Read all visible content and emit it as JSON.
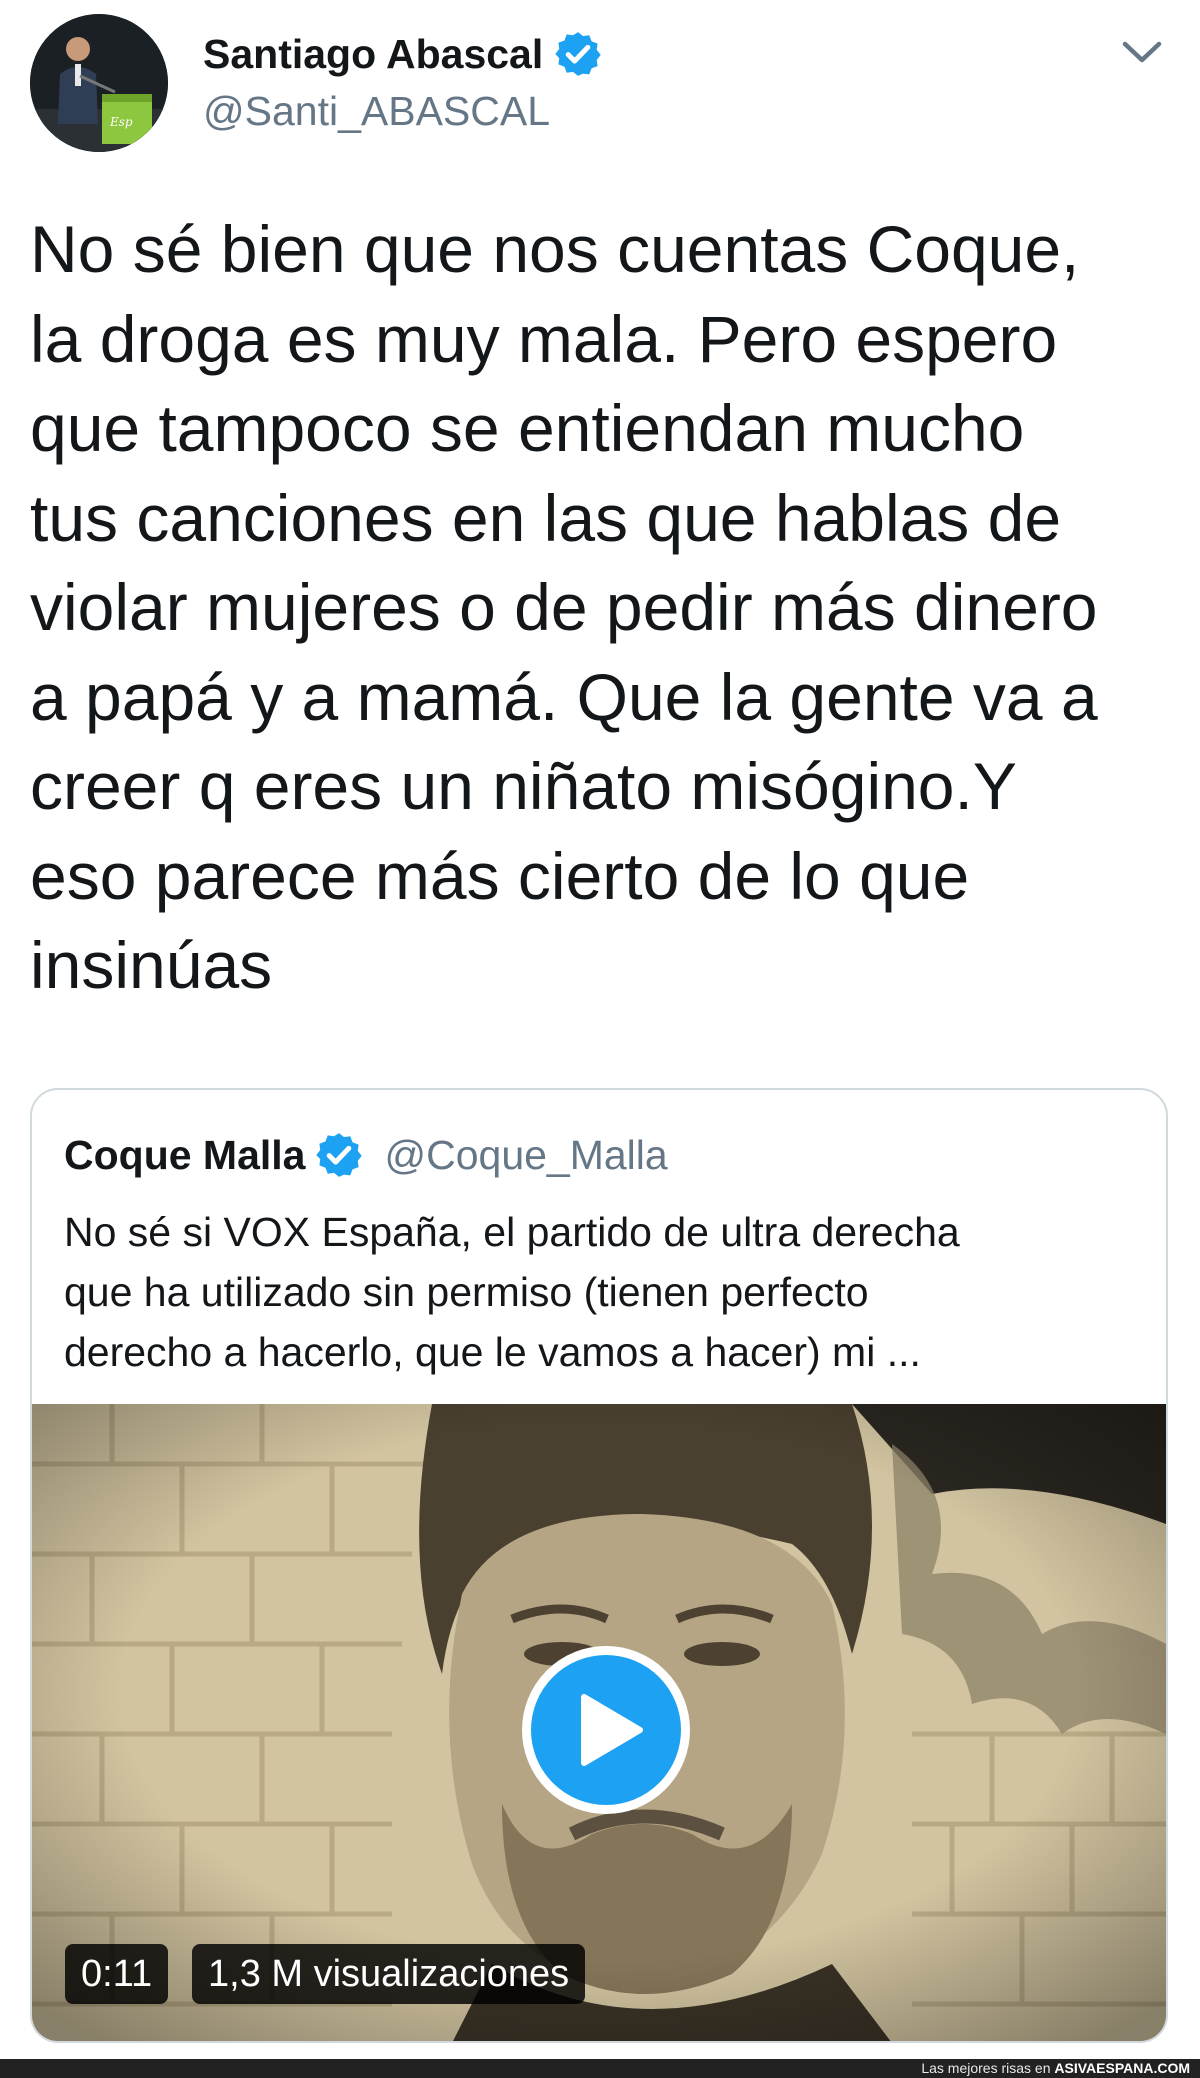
{
  "tweet": {
    "author": {
      "name": "Santiago Abascal",
      "handle": "@Santi_ABASCAL",
      "verified": true,
      "avatar_icon": "speaker-at-podium-avatar"
    },
    "text": "No sé bien que nos cuentas Coque,\nla droga es muy mala. Pero espero\nque tampoco se entiendan mucho\ntus canciones en las que hablas de\nviolar mujeres o de pedir más dinero\na papá y a mamá. Que la gente va a\ncreer q eres un niñato misógino.Y\neso parece más cierto de lo que\ninsinúas",
    "menu_icon": "chevron-down-icon"
  },
  "quoted_tweet": {
    "author": {
      "name": "Coque Malla",
      "handle": "@Coque_Malla",
      "verified": true
    },
    "text": "No sé si VOX España, el partido de ultra derecha\nque ha utilizado sin permiso (tienen perfecto\nderecho a hacerlo, que le vamos a hacer) mi ...",
    "video": {
      "duration": "0:11",
      "views": "1,3 M visualizaciones",
      "play_icon": "play-icon"
    }
  },
  "footer": {
    "prefix": "Las mejores risas en",
    "site": "ASIVAESPANA.COM"
  },
  "colors": {
    "verified_blue": "#1da1f2",
    "text_primary": "#14171a",
    "text_secondary": "#657786",
    "card_border": "#cfd9de"
  }
}
